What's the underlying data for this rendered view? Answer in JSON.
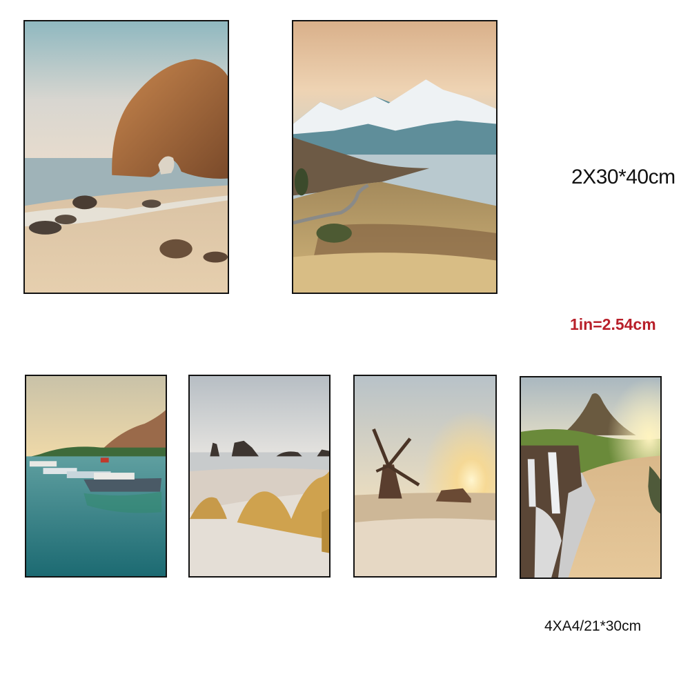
{
  "labels": {
    "large_size": "2X30*40cm",
    "conversion": "1in=2.54cm",
    "small_size": "4XA4/21*30cm"
  },
  "colors": {
    "conversion_text": "#b8202a",
    "frame_border": "#111111",
    "background": "#ffffff"
  },
  "posters": [
    {
      "scene": "sea-arch-beach",
      "format": "30x40cm"
    },
    {
      "scene": "snow-mountain-lake",
      "format": "30x40cm"
    },
    {
      "scene": "harbor-boats",
      "format": "A4"
    },
    {
      "scene": "beach-dunes-grass",
      "format": "A4"
    },
    {
      "scene": "windmill-sunset",
      "format": "A4"
    },
    {
      "scene": "waterfall-mountain",
      "format": "A4"
    }
  ]
}
